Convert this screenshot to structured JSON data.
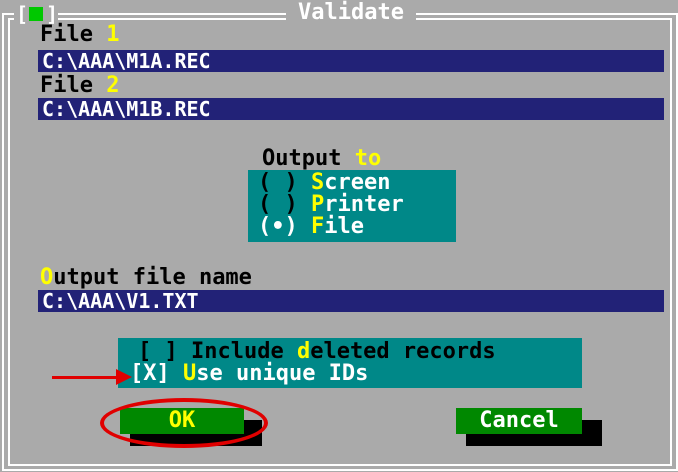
{
  "window": {
    "title": "Validate",
    "close_box": {
      "left": "[",
      "nub": "■",
      "right": "]"
    }
  },
  "file1": {
    "label": "File",
    "number": "1",
    "value": "C:\\AAA\\M1A.REC"
  },
  "file2": {
    "label": "File",
    "number": "2",
    "value": "C:\\AAA\\M1B.REC"
  },
  "output": {
    "label": "Output",
    "label_hot": "to",
    "options": [
      {
        "prefix": "( ) ",
        "hot": "S",
        "rest": "creen",
        "selected": false
      },
      {
        "prefix": "( ) ",
        "hot": "P",
        "rest": "rinter",
        "selected": false
      },
      {
        "prefix": "(•) ",
        "hot": "F",
        "rest": "ile",
        "selected": true
      }
    ]
  },
  "output_file": {
    "label_hot": "O",
    "label_rest": "utput file name",
    "value": "C:\\AAA\\V1.TXT"
  },
  "options": [
    {
      "box": "[ ] ",
      "pre": "Include ",
      "hot": "d",
      "rest": "eleted records",
      "checked": false
    },
    {
      "box": "[X] ",
      "pre": "",
      "hot": "U",
      "rest": "se unique IDs",
      "checked": true
    }
  ],
  "buttons": {
    "ok": {
      "label": "OK"
    },
    "cancel": {
      "label": "Cancel"
    }
  },
  "colors": {
    "dialog_bg": "#aaaaaa",
    "field_bg": "#222277",
    "group_bg": "#008888",
    "button_bg": "#008800",
    "hotkey": "#ffff00",
    "annotation": "#e00000"
  }
}
